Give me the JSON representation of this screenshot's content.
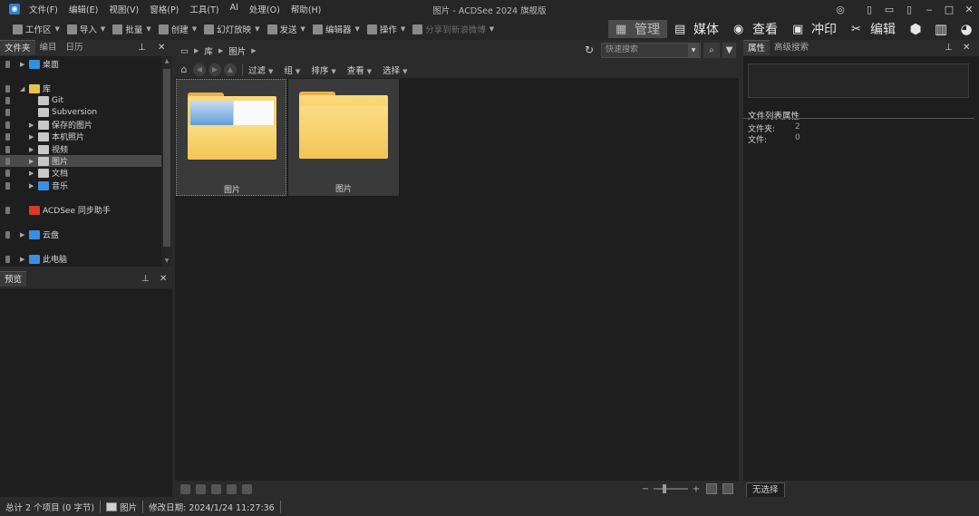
{
  "window": {
    "title": "图片 - ACDSee 2024 旗舰版",
    "controls": [
      "user",
      "layout-left",
      "layout-full",
      "layout-right",
      "minimize",
      "maximize",
      "close"
    ]
  },
  "menu": [
    "文件(F)",
    "编辑(E)",
    "视图(V)",
    "窗格(P)",
    "工具(T)",
    "AI",
    "处理(O)",
    "帮助(H)"
  ],
  "toolbar": {
    "items": [
      {
        "label": "工作区",
        "icon": "workspace-icon",
        "dropdown": true
      },
      {
        "label": "导入",
        "icon": "import-icon",
        "dropdown": true
      },
      {
        "label": "批量",
        "icon": "batch-icon",
        "dropdown": true
      },
      {
        "label": "创建",
        "icon": "create-icon",
        "dropdown": true
      },
      {
        "label": "幻灯放映",
        "icon": "slideshow-icon",
        "dropdown": true
      },
      {
        "label": "发送",
        "icon": "send-icon",
        "dropdown": true
      },
      {
        "label": "编辑器",
        "icon": "editor-icon",
        "dropdown": true
      },
      {
        "label": "操作",
        "icon": "actions-icon",
        "dropdown": true
      },
      {
        "label": "分享到新浪微博",
        "icon": "weibo-share-icon",
        "dropdown": true,
        "disabled": true
      }
    ],
    "modes": [
      {
        "label": "管理",
        "icon": "manage-grid-icon",
        "active": true
      },
      {
        "label": "媒体",
        "icon": "media-icon",
        "active": false
      },
      {
        "label": "查看",
        "icon": "view-eye-icon",
        "active": false
      },
      {
        "label": "冲印",
        "icon": "develop-icon",
        "active": false
      },
      {
        "label": "编辑",
        "icon": "edit-tools-icon",
        "active": false
      }
    ],
    "extra_icons": [
      "dashboard-icon",
      "stats-icon",
      "people-icon"
    ]
  },
  "folders_panel": {
    "tabs": [
      "文件夹",
      "编目",
      "日历"
    ],
    "active_tab": 0,
    "tree": [
      {
        "label": "桌面",
        "icon": "desktop-icon",
        "color": "#2f8fe0",
        "level": 0,
        "expandable": true,
        "expanded": false,
        "selected": false
      },
      {
        "label": "库",
        "icon": "library-icon",
        "color": "#e8c04a",
        "level": 0,
        "expandable": true,
        "expanded": true,
        "selected": false
      },
      {
        "label": "Git",
        "icon": "git-folder-icon",
        "color": "#c8c8c8",
        "level": 1,
        "expandable": false,
        "expanded": false,
        "selected": false
      },
      {
        "label": "Subversion",
        "icon": "svn-folder-icon",
        "color": "#c8c8c8",
        "level": 1,
        "expandable": false,
        "expanded": false,
        "selected": false
      },
      {
        "label": "保存的图片",
        "icon": "saved-pictures-icon",
        "color": "#c8c8c8",
        "level": 1,
        "expandable": true,
        "expanded": false,
        "selected": false
      },
      {
        "label": "本机照片",
        "icon": "camera-roll-icon",
        "color": "#c8c8c8",
        "level": 1,
        "expandable": true,
        "expanded": false,
        "selected": false
      },
      {
        "label": "视频",
        "icon": "videos-icon",
        "color": "#c8c8c8",
        "level": 1,
        "expandable": true,
        "expanded": false,
        "selected": false
      },
      {
        "label": "图片",
        "icon": "pictures-icon",
        "color": "#c8c8c8",
        "level": 1,
        "expandable": true,
        "expanded": false,
        "selected": true
      },
      {
        "label": "文档",
        "icon": "documents-icon",
        "color": "#c8c8c8",
        "level": 1,
        "expandable": true,
        "expanded": false,
        "selected": false
      },
      {
        "label": "音乐",
        "icon": "music-icon",
        "color": "#3a8fe0",
        "level": 1,
        "expandable": true,
        "expanded": false,
        "selected": false
      },
      {
        "label": "ACDSee 同步助手",
        "icon": "acdsee-sync-icon",
        "color": "#d83a2f",
        "level": 0,
        "expandable": false,
        "expanded": false,
        "selected": false
      },
      {
        "label": "云盘",
        "icon": "cloud-drive-icon",
        "color": "#3a8fe0",
        "level": 0,
        "expandable": true,
        "expanded": false,
        "selected": false
      },
      {
        "label": "此电脑",
        "icon": "this-pc-icon",
        "color": "#3a8fe0",
        "level": 0,
        "expandable": true,
        "expanded": false,
        "selected": false
      }
    ]
  },
  "preview_panel": {
    "title": "预览"
  },
  "path_bar": {
    "crumbs": [
      "库",
      "图片"
    ],
    "search_placeholder": "快速搜索"
  },
  "list_toolbar": {
    "items": [
      {
        "label": "过滤"
      },
      {
        "label": "组"
      },
      {
        "label": "排序"
      },
      {
        "label": "查看"
      },
      {
        "label": "选择"
      }
    ]
  },
  "files": [
    {
      "name": "图片",
      "has_thumbnails": true,
      "focused": true
    },
    {
      "name": "图片",
      "has_thumbnails": false,
      "focused": false
    }
  ],
  "properties_panel": {
    "tabs": [
      "属性",
      "高级搜索"
    ],
    "active_tab": 0,
    "section_title": "文件列表属性",
    "rows": [
      {
        "label": "文件夹:",
        "value": "2"
      },
      {
        "label": "文件:",
        "value": "0"
      }
    ],
    "bottom_tab": "无选择"
  },
  "status_bar": {
    "total": "总计 2 个项目 (0 字节)",
    "folder": "图片",
    "modified": "修改日期: 2024/1/24 11:27:36"
  }
}
